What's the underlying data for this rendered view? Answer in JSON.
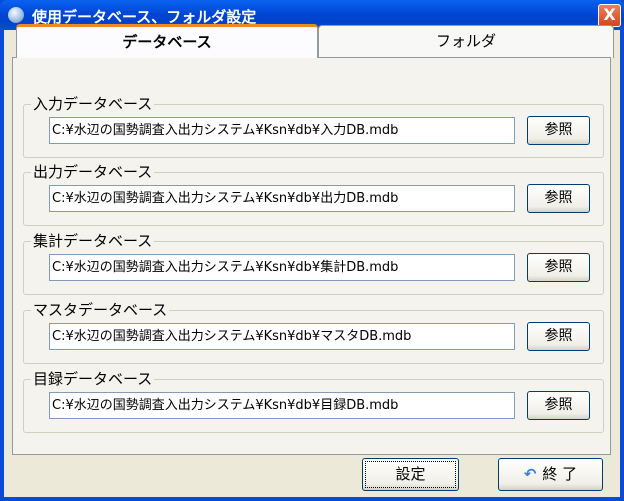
{
  "window": {
    "title": "使用データベース、フォルダ設定",
    "close_glyph": "X"
  },
  "tabs": [
    {
      "label": "データベース",
      "active": true
    },
    {
      "label": "フォルダ",
      "active": false
    }
  ],
  "groups": [
    {
      "legend": "入力データベース",
      "path": "C:¥水辺の国勢調査入出力システム¥Ksn¥db¥入力DB.mdb",
      "button": "参照"
    },
    {
      "legend": "出力データベース",
      "path": "C:¥水辺の国勢調査入出力システム¥Ksn¥db¥出力DB.mdb",
      "button": "参照"
    },
    {
      "legend": "集計データベース",
      "path": "C:¥水辺の国勢調査入出力システム¥Ksn¥db¥集計DB.mdb",
      "button": "参照"
    },
    {
      "legend": "マスタデータベース",
      "path": "C:¥水辺の国勢調査入出力システム¥Ksn¥db¥マスタDB.mdb",
      "button": "参照"
    },
    {
      "legend": "目録データベース",
      "path": "C:¥水辺の国勢調査入出力システム¥Ksn¥db¥目録DB.mdb",
      "button": "参照"
    }
  ],
  "footer": {
    "set_label": "設定",
    "exit_label": "終 了",
    "exit_icon": "undo-arrow-icon"
  }
}
